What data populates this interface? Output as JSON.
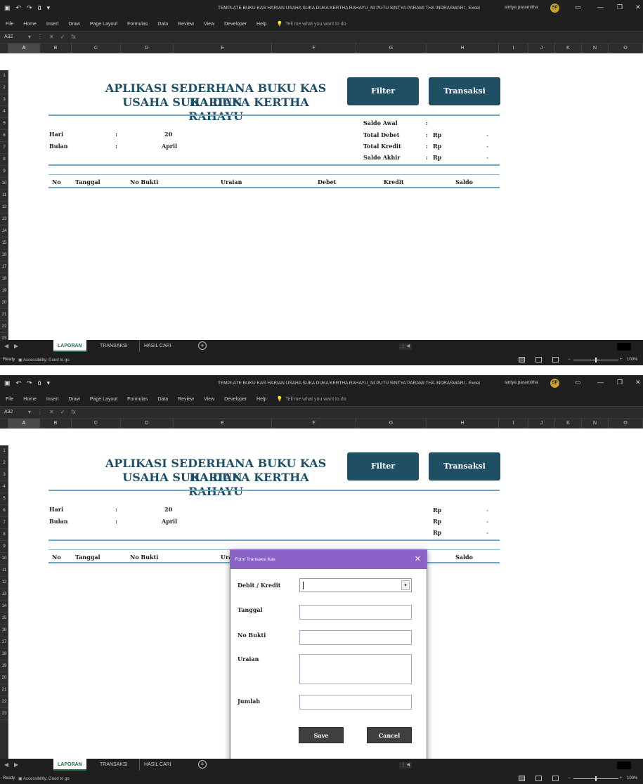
{
  "window": {
    "title": "TEMPLATE BUKU KAS HARIAN USAHA SUKA DUKA KERTHA RAHAYU_NI PUTU SINTYA PARAMI THA INDRASWARI  -  Excel",
    "user": "sintya paramitha",
    "avatar": "SP",
    "qat": [
      "▣",
      "↶",
      "↷",
      "ɑ̈",
      "▾"
    ],
    "controls": [
      "▭",
      "—",
      "❐",
      "✕"
    ]
  },
  "ribbon": {
    "tabs": [
      "File",
      "Home",
      "Insert",
      "Draw",
      "Page Layout",
      "Formulas",
      "Data",
      "Review",
      "View",
      "Developer",
      "Help"
    ],
    "tell_me": "Tell me what you want to do",
    "tell_icon": "💡"
  },
  "formula_bar": {
    "name_box": "A32",
    "icons": [
      "▾",
      "⋮",
      "✕",
      "✓",
      "fx"
    ]
  },
  "columns": [
    "A",
    "B",
    "C",
    "D",
    "E",
    "F",
    "G",
    "H",
    "I",
    "J",
    "K",
    "N",
    "O"
  ],
  "rows": [
    "1",
    "2",
    "3",
    "4",
    "5",
    "6",
    "7",
    "8",
    "9",
    "10",
    "11",
    "12",
    "13",
    "14",
    "15",
    "16",
    "17",
    "18",
    "19",
    "20",
    "21",
    "22",
    "23"
  ],
  "sheet": {
    "title_line1": "APLIKASI SEDERHANA BUKU KAS HARIAN",
    "title_line2": "USAHA SUKA DUKA KERTHA RAHAYU",
    "filter_button": "Filter",
    "transaksi_button": "Transaksi",
    "hari_label": "Hari",
    "hari_colon": ":",
    "hari_value": "20",
    "bulan_label": "Bulan",
    "bulan_colon": ":",
    "bulan_value": "April",
    "summary": [
      {
        "label": "Saldo Awal",
        "colon": ":",
        "currency": "",
        "value": ""
      },
      {
        "label": "Total Debet",
        "colon": ":",
        "currency": "Rp",
        "value": "-"
      },
      {
        "label": "Total Kredit",
        "colon": ":",
        "currency": "Rp",
        "value": "-"
      },
      {
        "label": "Saldo Akhir",
        "colon": ":",
        "currency": "Rp",
        "value": "-"
      }
    ],
    "table_headers": [
      "No",
      "Tanggal",
      "No Bukti",
      "Uraian",
      "Debet",
      "Kredit",
      "Saldo"
    ]
  },
  "sheet_tabs": {
    "tabs": [
      "LAPORAN",
      "TRANSAKSI",
      "HASIL CARI"
    ],
    "active": "LAPORAN",
    "add": "+"
  },
  "status_bar": {
    "ready": "Ready",
    "accessibility": "Accessibility: Good to go",
    "zoom": "100%"
  },
  "dialog": {
    "title": "Form Transaksi Kas",
    "close": "✕",
    "fields": {
      "debit_kredit": "Debit / Kredit",
      "tanggal": "Tanggal",
      "no_bukti": "No Bukti",
      "uraian": "Uraian",
      "jumlah": "Jumlah"
    },
    "combo_caret": "▾",
    "save": "Save",
    "cancel": "Cancel"
  },
  "colors": {
    "title_blue": "#1e4f66",
    "button_teal": "#1e4f63",
    "dialog_purple": "#8a62c8",
    "excel_green": "#1d6f42"
  }
}
